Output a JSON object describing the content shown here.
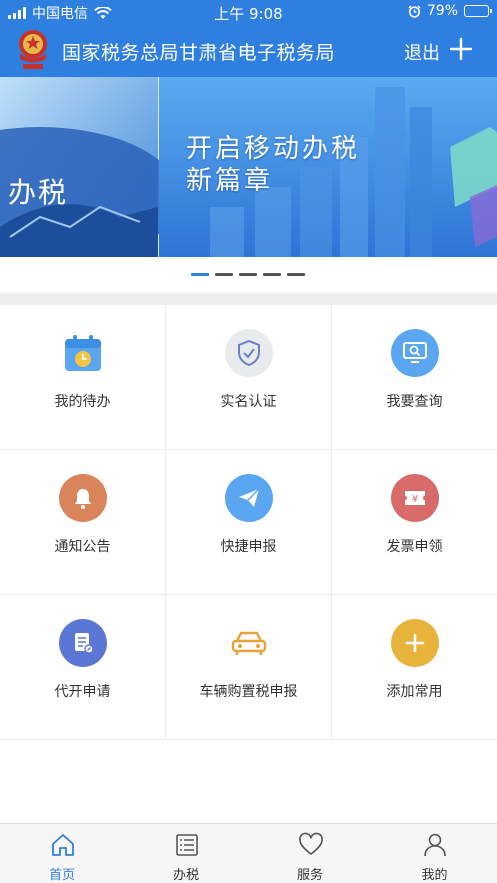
{
  "status_bar": {
    "carrier": "中国电信",
    "time": "上午 9:08",
    "battery_percent": "79%",
    "battery_level": 0.79,
    "icons": [
      "signal-icon",
      "wifi-icon",
      "alarm-icon",
      "battery-icon"
    ]
  },
  "header": {
    "title": "国家税务总局甘肃省电子税务局",
    "logout_label": "退出",
    "add_icon": "plus-icon",
    "background": "#2f7fe0"
  },
  "banner": {
    "line1": "开启移动办税",
    "line2": "新篇章",
    "left_fragment": "办税",
    "page_count": 5,
    "active_page": 1
  },
  "grid": {
    "items": [
      {
        "label": "我的待办",
        "icon": "calendar-clock-icon",
        "color": "#5aa6f0"
      },
      {
        "label": "实名认证",
        "icon": "shield-check-icon",
        "color": "#e8eaee"
      },
      {
        "label": "我要查询",
        "icon": "search-monitor-icon",
        "color": "#5aa6f0"
      },
      {
        "label": "通知公告",
        "icon": "bell-icon",
        "color": "#d9845a"
      },
      {
        "label": "快捷申报",
        "icon": "paper-plane-icon",
        "color": "#5aa6f0"
      },
      {
        "label": "发票申领",
        "icon": "invoice-icon",
        "color": "#d96a6a"
      },
      {
        "label": "代开申请",
        "icon": "document-edit-icon",
        "color": "#5b77d6"
      },
      {
        "label": "车辆购置税申报",
        "icon": "car-icon",
        "color": "#ffffff"
      },
      {
        "label": "添加常用",
        "icon": "plus-circle-icon",
        "color": "#e8b33a"
      }
    ]
  },
  "tabbar": {
    "tabs": [
      {
        "label": "首页",
        "icon": "home-icon",
        "active": true
      },
      {
        "label": "办税",
        "icon": "list-icon",
        "active": false
      },
      {
        "label": "服务",
        "icon": "heart-icon",
        "active": false
      },
      {
        "label": "我的",
        "icon": "user-icon",
        "active": false
      }
    ],
    "active_color": "#2f7fe0"
  }
}
